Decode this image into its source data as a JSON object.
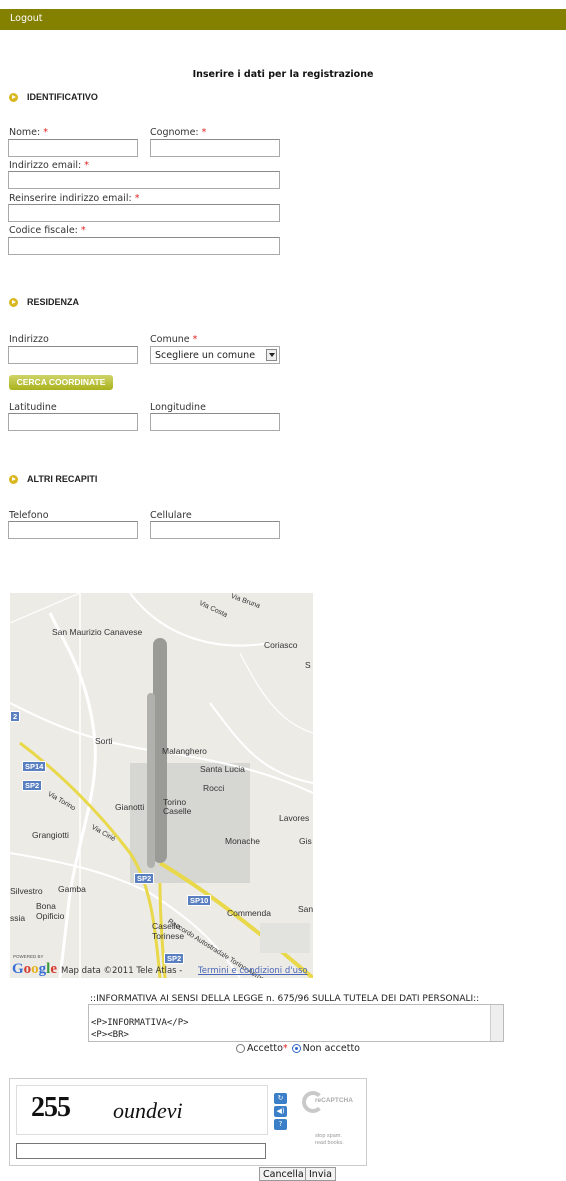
{
  "topbar": {
    "logout_label": "Logout",
    "color": "#848000"
  },
  "form_title": "Inserire i dati per la registrazione",
  "required_mark": "*",
  "sections": {
    "identificativo": "IDENTIFICATIVO",
    "residenza": "RESIDENZA",
    "altri_recapiti": "ALTRI RECAPITI"
  },
  "labels": {
    "nome": "Nome:",
    "cognome": "Cognome:",
    "email": "Indirizzo email:",
    "email_repeat": "Reinserire indirizzo email:",
    "codice_fiscale": "Codice fiscale:",
    "indirizzo": "Indirizzo",
    "comune": "Comune",
    "latitudine": "Latitudine",
    "longitudine": "Longitudine",
    "telefono": "Telefono",
    "cellulare": "Cellulare"
  },
  "comune_select": {
    "selected": "Scegliere un comune"
  },
  "cerca_button": "CERCA COORDINATE",
  "map": {
    "places": [
      "San Maurizio Canavese",
      "Coriasco",
      "Sorti",
      "Malanghero",
      "Santa Lucia",
      "Rocci",
      "Torino Caselle",
      "Gianotti",
      "Lavores",
      "Grangiotti",
      "Monache",
      "Gis",
      "Silvestro",
      "Gamba",
      "Bona Opificio",
      "Commenda",
      "Sant",
      "Caselle Torinese",
      "ssia",
      "S"
    ],
    "roads": [
      "Via Bruna",
      "Via Costa",
      "Via Torino",
      "Via Cirié",
      "Raccordo Autostradale Torino-Aeroporto di Caselle"
    ],
    "shields": [
      "SP14",
      "SP2",
      "SP2",
      "SP10",
      "2",
      "SP2"
    ],
    "powered_by": "POWERED BY",
    "google": "Google",
    "mapdata": "Map data ©2011 Tele Atlas -",
    "terms": "Termini e condizioni d'uso"
  },
  "informativa": {
    "title": "::INFORMATIVA AI SENSI DELLA LEGGE n. 675/96 SULLA TUTELA DEI DATI PERSONALI::",
    "line1": "<P>INFORMATIVA</P>",
    "line2": "<P><BR>"
  },
  "consent": {
    "accept": "Accetto",
    "decline": "Non accetto",
    "selected": "Non accetto"
  },
  "captcha": {
    "word1": "255",
    "word2": "oundevi",
    "logo": "reCAPTCHA",
    "tagline1": "stop spam.",
    "tagline2": "read books."
  },
  "buttons": {
    "cancel": "Cancella",
    "submit": "Invia"
  }
}
